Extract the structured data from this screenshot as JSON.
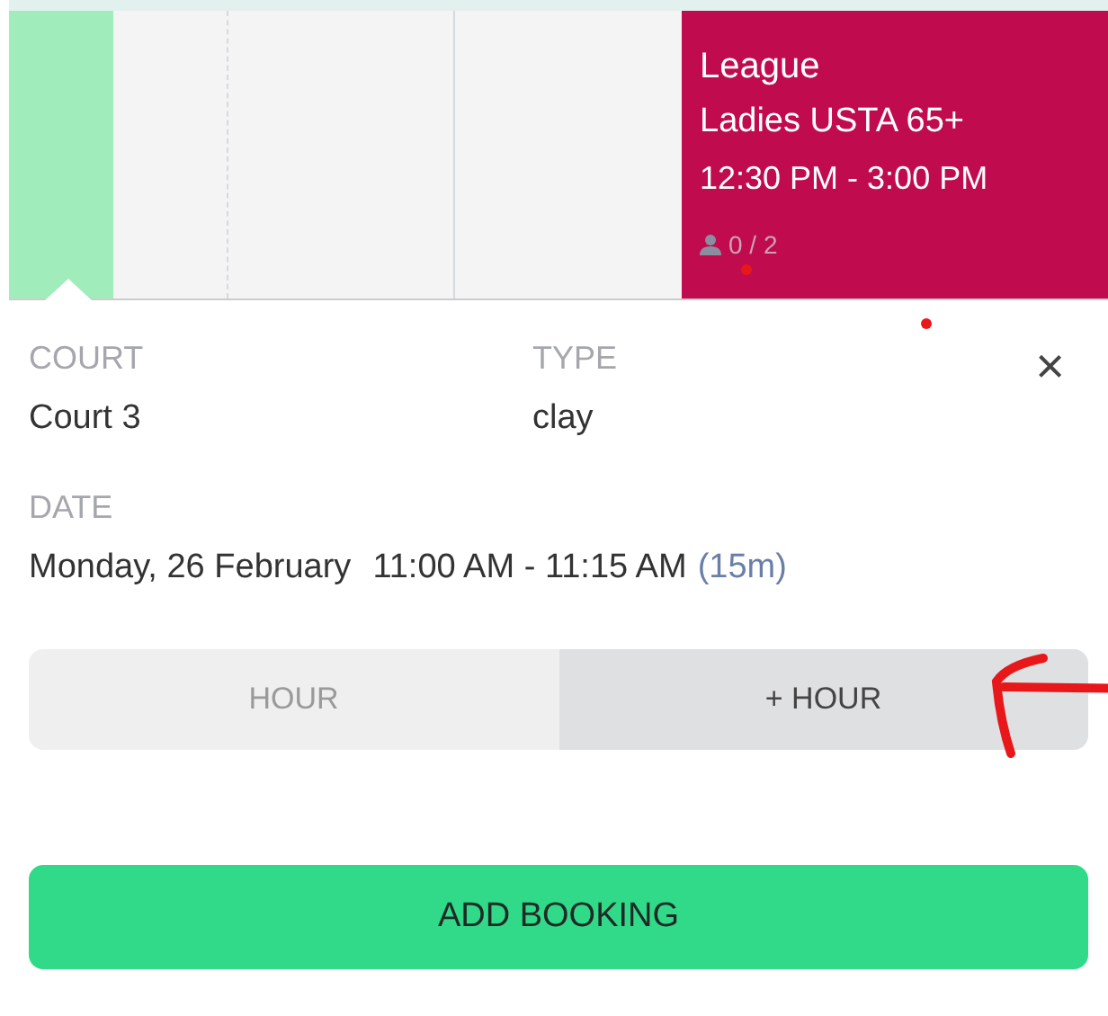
{
  "slots": [
    {
      "selected": true
    },
    {
      "selected": false
    },
    {
      "selected": false
    },
    {
      "selected": false
    }
  ],
  "event": {
    "category": "League",
    "title": "Ladies USTA 65+",
    "time": "12:30 PM - 3:00 PM",
    "attendees": "0 / 2",
    "color": "#c00c4f"
  },
  "popup": {
    "court": {
      "label": "COURT",
      "value": "Court 3"
    },
    "type": {
      "label": "TYPE",
      "value": "clay"
    },
    "close": "×",
    "date": {
      "label": "DATE",
      "day": "Monday, 26 February",
      "time": "11:00 AM - 11:15 AM",
      "duration": "(15m)"
    },
    "duration_buttons": [
      {
        "label": "HOUR",
        "disabled": true
      },
      {
        "label": "+ HOUR",
        "disabled": false
      }
    ],
    "submit": "ADD BOOKING"
  }
}
